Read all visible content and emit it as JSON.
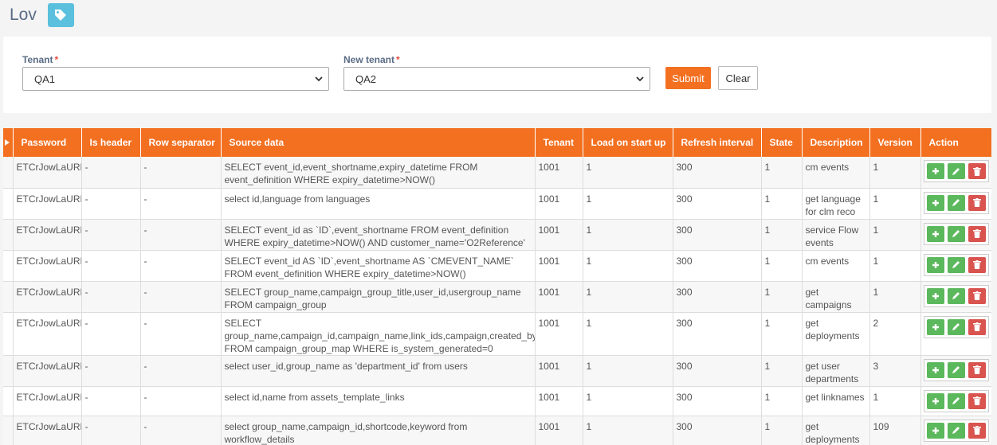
{
  "page": {
    "title": "Lov",
    "tag_icon": "tag-icon"
  },
  "filters": {
    "tenant": {
      "label": "Tenant",
      "required_mark": "*",
      "value": "QA1"
    },
    "new_tenant": {
      "label": "New tenant",
      "required_mark": "*",
      "value": "QA2"
    },
    "submit_label": "Submit",
    "clear_label": "Clear"
  },
  "table": {
    "columns": [
      "Password",
      "Is header",
      "Row separator",
      "Source data",
      "Tenant",
      "Load on start up",
      "Refresh interval",
      "State",
      "Description",
      "Version",
      "Action"
    ],
    "rows": [
      {
        "password": "ETCrJowLaURL",
        "is_header": "-",
        "row_separator": "-",
        "source_data": "SELECT event_id,event_shortname,expiry_datetime FROM event_definition WHERE expiry_datetime>NOW()",
        "tenant": "1001",
        "load": "1",
        "refresh": "300",
        "state": "1",
        "description": "cm events",
        "version": "1"
      },
      {
        "password": "ETCrJowLaURL",
        "is_header": "-",
        "row_separator": "-",
        "source_data": "select id,language from languages",
        "tenant": "1001",
        "load": "1",
        "refresh": "300",
        "state": "1",
        "description": "get language for clm reco",
        "version": "1"
      },
      {
        "password": "ETCrJowLaURL",
        "is_header": "-",
        "row_separator": "-",
        "source_data": "SELECT event_id as `ID`,event_shortname FROM event_definition WHERE expiry_datetime>NOW() AND customer_name='O2Reference'",
        "tenant": "1001",
        "load": "1",
        "refresh": "300",
        "state": "1",
        "description": "service Flow events",
        "version": "1"
      },
      {
        "password": "ETCrJowLaURL",
        "is_header": "-",
        "row_separator": "-",
        "source_data": "SELECT event_id AS `ID`,event_shortname AS `CMEVENT_NAME` FROM event_definition WHERE expiry_datetime>NOW()",
        "tenant": "1001",
        "load": "1",
        "refresh": "300",
        "state": "1",
        "description": "cm events",
        "version": "1"
      },
      {
        "password": "ETCrJowLaURL",
        "is_header": "-",
        "row_separator": "-",
        "source_data": "SELECT group_name,campaign_group_title,user_id,usergroup_name FROM campaign_group",
        "tenant": "1001",
        "load": "1",
        "refresh": "300",
        "state": "1",
        "description": "get campaigns",
        "version": "1"
      },
      {
        "password": "ETCrJowLaURL",
        "is_header": "-",
        "row_separator": "-",
        "source_data": "SELECT group_name,campaign_id,campaign_name,link_ids,campaign,created_by FROM campaign_group_map WHERE is_system_generated=0",
        "tenant": "1001",
        "load": "1",
        "refresh": "300",
        "state": "1",
        "description": "get deployments",
        "version": "2"
      },
      {
        "password": "ETCrJowLaURL",
        "is_header": "-",
        "row_separator": "-",
        "source_data": "select user_id,group_name as 'department_id' from users",
        "tenant": "1001",
        "load": "1",
        "refresh": "300",
        "state": "1",
        "description": "get user departments",
        "version": "3"
      },
      {
        "password": "ETCrJowLaURL",
        "is_header": "-",
        "row_separator": "-",
        "source_data": "select id,name from assets_template_links",
        "tenant": "1001",
        "load": "1",
        "refresh": "300",
        "state": "1",
        "description": "get linknames",
        "version": "1"
      },
      {
        "password": "ETCrJowLaURL",
        "is_header": "-",
        "row_separator": "-",
        "source_data": "select group_name,campaign_id,shortcode,keyword from workflow_details",
        "tenant": "1001",
        "load": "1",
        "refresh": "300",
        "state": "1",
        "description": "get deployments",
        "version": "109"
      }
    ]
  },
  "colors": {
    "accent": "#f37021",
    "info": "#5bc0de",
    "success": "#5cb85c",
    "danger": "#d9534f"
  }
}
